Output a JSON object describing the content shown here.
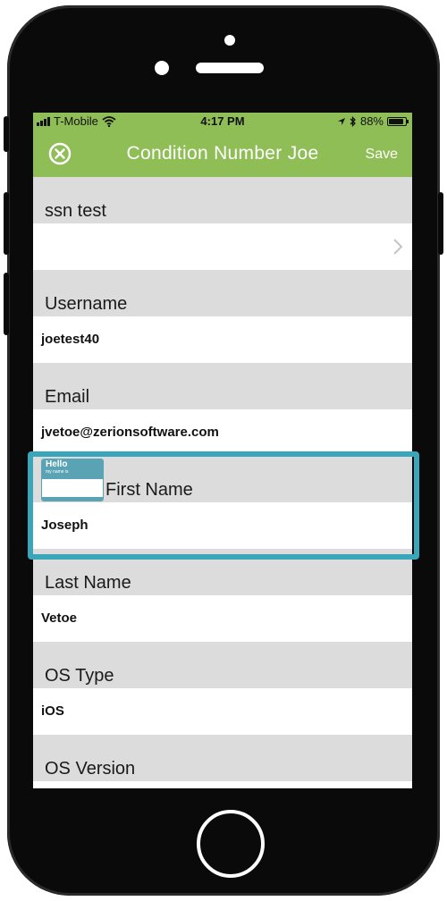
{
  "status_bar": {
    "carrier": "T-Mobile",
    "time": "4:17 PM",
    "battery": "88%",
    "battery_level": 0.88
  },
  "nav": {
    "title": "Condition Number Joe",
    "save_label": "Save",
    "close_icon": "close-circle-icon"
  },
  "fields": [
    {
      "label": "ssn test",
      "value": ""
    },
    {
      "label": "Username",
      "value": "joetest40"
    },
    {
      "label": "Email",
      "value": "jvetoe@zerionsoftware.com"
    },
    {
      "label": "First Name",
      "value": "Joseph",
      "icon": "name-tag-icon",
      "icon_text": "Hello",
      "icon_subtext": "my name is"
    },
    {
      "label": "Last Name",
      "value": "Vetoe"
    },
    {
      "label": "OS Type",
      "value": "iOS"
    },
    {
      "label": "OS Version",
      "value": ""
    }
  ],
  "colors": {
    "accent": "#8fbd56",
    "highlight": "#3aa6b9",
    "name_tag": "#5aa3b5",
    "label_bg": "#dcdcdc"
  }
}
